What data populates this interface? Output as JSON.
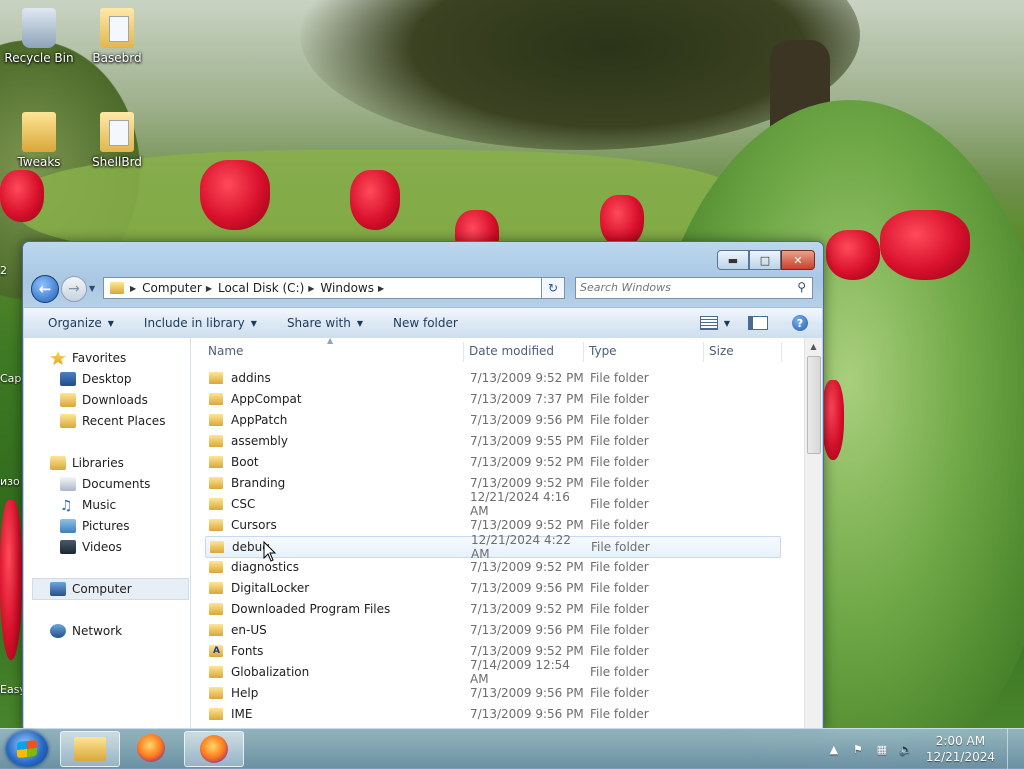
{
  "desktop": {
    "icons": [
      {
        "label": "Recycle Bin",
        "icon": "recycle-bin-icon"
      },
      {
        "label": "Basebrd",
        "icon": "document-icon"
      },
      {
        "label": "Tweaks",
        "icon": "folder-icon"
      },
      {
        "label": "ShellBrd",
        "icon": "document-icon"
      }
    ],
    "partial_labels": [
      "2",
      "Cap",
      "изо",
      "Easy"
    ]
  },
  "window": {
    "address": {
      "crumbs": [
        "Computer",
        "Local Disk (C:)",
        "Windows"
      ]
    },
    "search_placeholder": "Search Windows",
    "toolbar": {
      "organize": "Organize",
      "include_in_library": "Include in library",
      "share_with": "Share with",
      "new_folder": "New folder"
    },
    "nav": {
      "favorites": "Favorites",
      "desktop": "Desktop",
      "downloads": "Downloads",
      "recent_places": "Recent Places",
      "libraries": "Libraries",
      "documents": "Documents",
      "music": "Music",
      "pictures": "Pictures",
      "videos": "Videos",
      "computer": "Computer",
      "network": "Network"
    },
    "columns": {
      "name": "Name",
      "date_modified": "Date modified",
      "type": "Type",
      "size": "Size"
    },
    "rows": [
      {
        "name": "addins",
        "date": "7/13/2009 9:52 PM",
        "type": "File folder"
      },
      {
        "name": "AppCompat",
        "date": "7/13/2009 7:37 PM",
        "type": "File folder"
      },
      {
        "name": "AppPatch",
        "date": "7/13/2009 9:56 PM",
        "type": "File folder"
      },
      {
        "name": "assembly",
        "date": "7/13/2009 9:55 PM",
        "type": "File folder"
      },
      {
        "name": "Boot",
        "date": "7/13/2009 9:52 PM",
        "type": "File folder"
      },
      {
        "name": "Branding",
        "date": "7/13/2009 9:52 PM",
        "type": "File folder"
      },
      {
        "name": "CSC",
        "date": "12/21/2024 4:16 AM",
        "type": "File folder"
      },
      {
        "name": "Cursors",
        "date": "7/13/2009 9:52 PM",
        "type": "File folder"
      },
      {
        "name": "debug",
        "date": "12/21/2024 4:22 AM",
        "type": "File folder"
      },
      {
        "name": "diagnostics",
        "date": "7/13/2009 9:52 PM",
        "type": "File folder"
      },
      {
        "name": "DigitalLocker",
        "date": "7/13/2009 9:56 PM",
        "type": "File folder"
      },
      {
        "name": "Downloaded Program Files",
        "date": "7/13/2009 9:52 PM",
        "type": "File folder"
      },
      {
        "name": "en-US",
        "date": "7/13/2009 9:56 PM",
        "type": "File folder"
      },
      {
        "name": "Fonts",
        "date": "7/13/2009 9:52 PM",
        "type": "File folder"
      },
      {
        "name": "Globalization",
        "date": "7/14/2009 12:54 AM",
        "type": "File folder"
      },
      {
        "name": "Help",
        "date": "7/13/2009 9:56 PM",
        "type": "File folder"
      },
      {
        "name": "IME",
        "date": "7/13/2009 9:56 PM",
        "type": "File folder"
      }
    ]
  },
  "taskbar": {
    "time": "2:00 AM",
    "date": "12/21/2024",
    "pinned": [
      "windows-explorer-icon",
      "firefox-icon",
      "firefox-icon"
    ]
  }
}
